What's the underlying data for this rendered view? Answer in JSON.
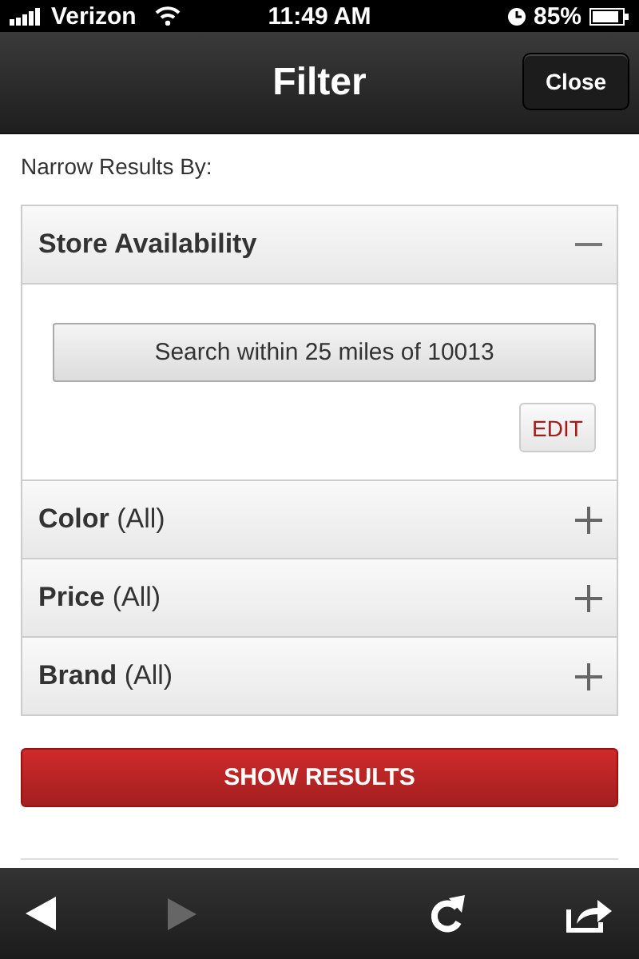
{
  "status_bar": {
    "carrier": "Verizon",
    "time": "11:49 AM",
    "battery": "85%"
  },
  "nav_bar": {
    "title": "Filter",
    "close_button": "Close"
  },
  "intro": "Narrow Results By:",
  "sections": [
    {
      "title": "Store Availability",
      "expanded": true,
      "search_button": "Search within 25 miles of 10013",
      "edit_button": "EDIT"
    },
    {
      "title": "Color",
      "filter": "(All)",
      "expanded": false
    },
    {
      "title": "Price",
      "filter": "(All)",
      "expanded": false
    },
    {
      "title": "Brand",
      "filter": "(All)",
      "expanded": false
    }
  ],
  "show_results_button": "SHOW RESULTS",
  "toolbar": {
    "back_enabled": true,
    "forward_enabled": false
  }
}
